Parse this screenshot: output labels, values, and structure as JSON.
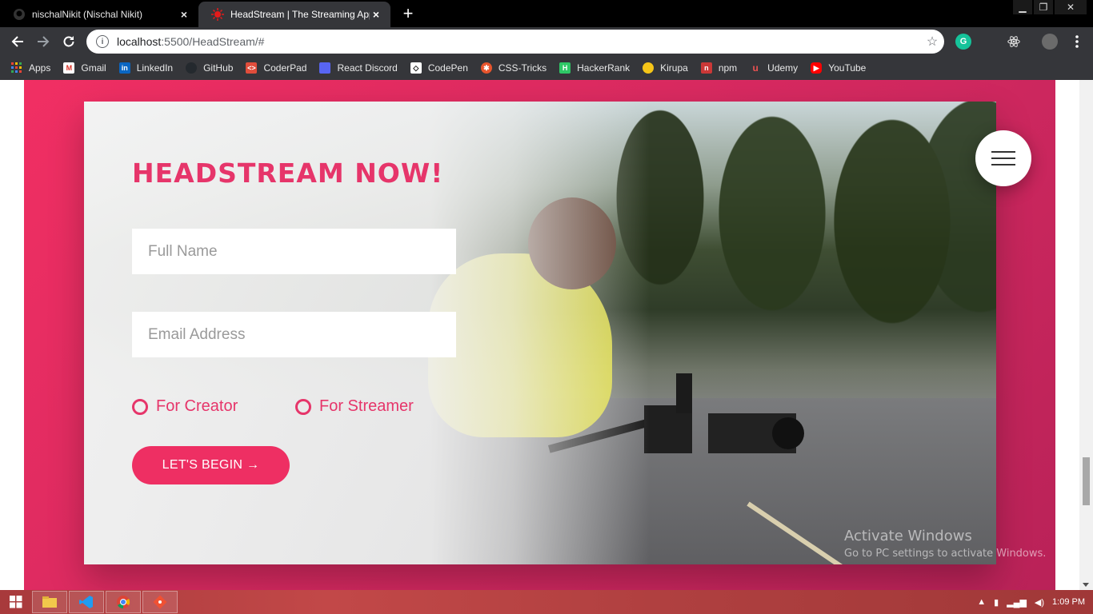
{
  "browser": {
    "tabs": [
      {
        "title": "nischalNikit (Nischal Nikit)",
        "active": false,
        "favicon": "github-icon"
      },
      {
        "title": "HeadStream | The Streaming App",
        "active": true,
        "favicon": "headstream-icon"
      }
    ],
    "close_glyph": "×",
    "new_tab_glyph": "+",
    "url_host": "localhost",
    "url_path": ":5500/HeadStream/#",
    "bookmarks": [
      {
        "label": "Apps",
        "icon": "apps-grid-icon",
        "color": "#4285f4"
      },
      {
        "label": "Gmail",
        "icon": "gmail-icon",
        "color": "#d93025"
      },
      {
        "label": "LinkedIn",
        "icon": "linkedin-icon",
        "color": "#0a66c2"
      },
      {
        "label": "GitHub",
        "icon": "github-icon",
        "color": "#24292e"
      },
      {
        "label": "CoderPad",
        "icon": "coderpad-icon",
        "color": "#e14d3b"
      },
      {
        "label": "React Discord",
        "icon": "discord-icon",
        "color": "#5865f2"
      },
      {
        "label": "CodePen",
        "icon": "codepen-icon",
        "color": "#ffffff"
      },
      {
        "label": "CSS-Tricks",
        "icon": "css-tricks-icon",
        "color": "#e8552d"
      },
      {
        "label": "HackerRank",
        "icon": "hackerrank-icon",
        "color": "#2ec866"
      },
      {
        "label": "Kirupa",
        "icon": "kirupa-icon",
        "color": "#f5c518"
      },
      {
        "label": "npm",
        "icon": "npm-icon",
        "color": "#cb3837"
      },
      {
        "label": "Udemy",
        "icon": "udemy-icon",
        "color": "#ec5252"
      },
      {
        "label": "YouTube",
        "icon": "youtube-icon",
        "color": "#ff0000"
      }
    ]
  },
  "page": {
    "heading": "HEADSTREAM NOW!",
    "form": {
      "full_name_placeholder": "Full Name",
      "email_placeholder": "Email Address",
      "radio_creator": "For Creator",
      "radio_streamer": "For Streamer",
      "submit_label": "LET'S BEGIN →"
    },
    "accent_color": "#e6356a",
    "watermark_title": "Activate Windows",
    "watermark_sub": "Go to PC settings to activate Windows."
  },
  "taskbar": {
    "clock": "1:09 PM",
    "apps": [
      "file-explorer-icon",
      "vscode-icon",
      "chrome-icon",
      "git-icon"
    ]
  }
}
